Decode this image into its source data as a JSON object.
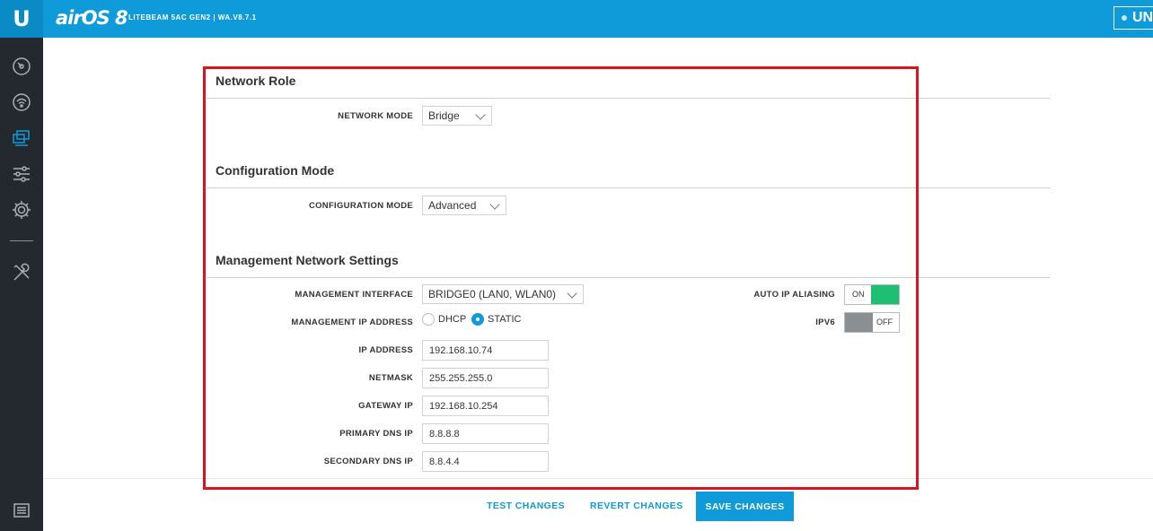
{
  "header": {
    "logo": "U",
    "brand": "airOS 8",
    "device": "LITEBEAM 5AC GEN2 | WA.V8.7.1",
    "right_badge": "UNI"
  },
  "sidebar": {
    "items": [
      {
        "icon": "dashboard-icon"
      },
      {
        "icon": "wireless-icon"
      },
      {
        "icon": "network-icon"
      },
      {
        "icon": "services-icon"
      },
      {
        "icon": "system-gear-icon"
      },
      {
        "icon": "tools-icon"
      },
      {
        "icon": "log-icon"
      }
    ]
  },
  "sections": {
    "network_role": "Network Role",
    "configuration_mode": "Configuration Mode",
    "management": "Management Network Settings"
  },
  "fields": {
    "network_mode": {
      "label": "NETWORK MODE",
      "value": "Bridge"
    },
    "configuration_mode": {
      "label": "CONFIGURATION MODE",
      "value": "Advanced"
    },
    "management_interface": {
      "label": "MANAGEMENT INTERFACE",
      "value": "BRIDGE0 (LAN0, WLAN0)"
    },
    "management_ip_address": {
      "label": "MANAGEMENT IP ADDRESS",
      "options": [
        "DHCP",
        "STATIC"
      ],
      "selected": "STATIC"
    },
    "ip_address": {
      "label": "IP ADDRESS",
      "value": "192.168.10.74"
    },
    "netmask": {
      "label": "NETMASK",
      "value": "255.255.255.0"
    },
    "gateway_ip": {
      "label": "GATEWAY IP",
      "value": "192.168.10.254"
    },
    "primary_dns": {
      "label": "PRIMARY DNS IP",
      "value": "8.8.8.8"
    },
    "secondary_dns": {
      "label": "SECONDARY DNS IP",
      "value": "8.8.4.4"
    },
    "auto_ip_aliasing": {
      "label": "AUTO IP ALIASING",
      "state": "ON"
    },
    "ipv6": {
      "label": "IPV6",
      "state": "OFF"
    }
  },
  "footer": {
    "test": "TEST CHANGES",
    "revert": "REVERT CHANGES",
    "save": "SAVE CHANGES"
  },
  "colors": {
    "accent": "#0f9ad9",
    "sidebar": "#24292f",
    "toggle_on": "#1fbf71",
    "highlight": "#d9141e"
  }
}
